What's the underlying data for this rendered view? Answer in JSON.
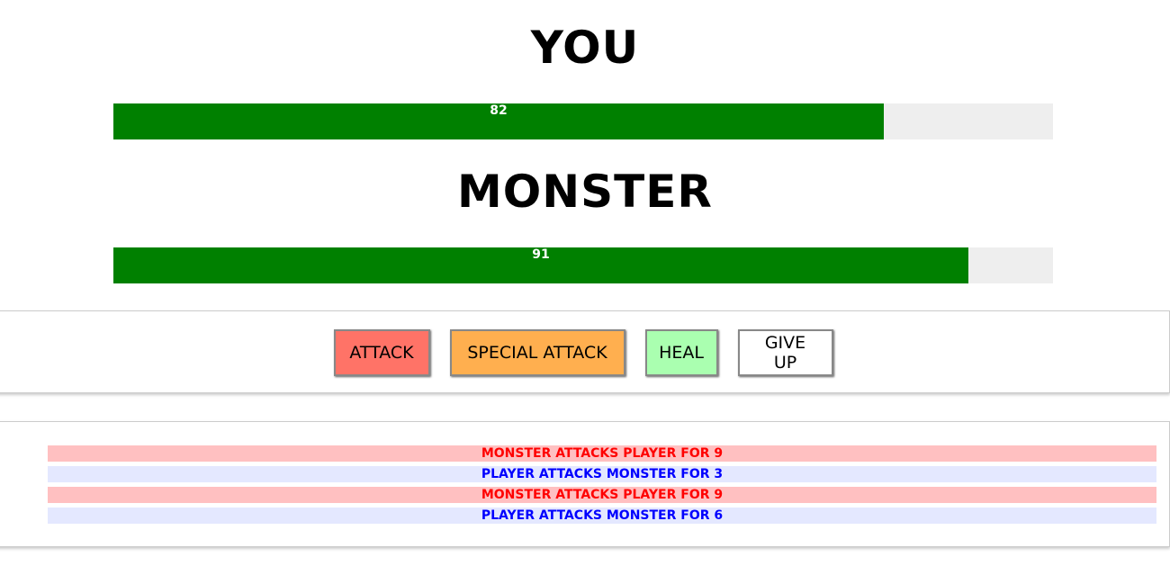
{
  "player": {
    "title": "YOU",
    "health": 82,
    "health_label": "82"
  },
  "monster": {
    "title": "MONSTER",
    "health": 91,
    "health_label": "91"
  },
  "controls": {
    "attack_label": "ATTACK",
    "special_attack_label": "SPECIAL ATTACK",
    "heal_label": "HEAL",
    "give_up_label": "GIVE UP"
  },
  "log": [
    {
      "type": "monster",
      "text": "MONSTER ATTACKS PLAYER FOR 9"
    },
    {
      "type": "player",
      "text": "PLAYER ATTACKS MONSTER FOR 3"
    },
    {
      "type": "monster",
      "text": "MONSTER ATTACKS PLAYER FOR 9"
    },
    {
      "type": "player",
      "text": "PLAYER ATTACKS MONSTER FOR 6"
    }
  ],
  "colors": {
    "health_bar": "#008000",
    "health_track": "#eeeeee",
    "attack_button": "#ff7367",
    "special_attack_button": "#ffaf4f",
    "heal_button": "#aaffb0",
    "give_up_button": "#ffffff",
    "monster_log_bg": "#ffc0c1",
    "monster_log_text": "#ff0000",
    "player_log_bg": "#e4e8ff",
    "player_log_text": "#0000ff"
  }
}
